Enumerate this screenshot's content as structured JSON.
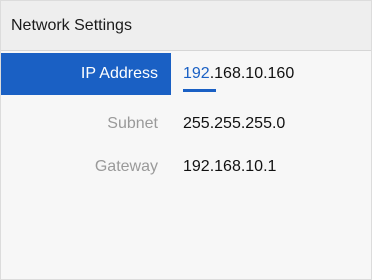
{
  "header": {
    "title": "Network Settings"
  },
  "rows": [
    {
      "label": "IP Address",
      "value_highlight": "192",
      "value_rest": ".168.10.160"
    },
    {
      "label": "Subnet",
      "value": "255.255.255.0"
    },
    {
      "label": "Gateway",
      "value": "192.168.10.1"
    }
  ],
  "colors": {
    "accent": "#1a60c4",
    "selected_text": "#ffffff",
    "muted_label": "#9a9a9a"
  }
}
